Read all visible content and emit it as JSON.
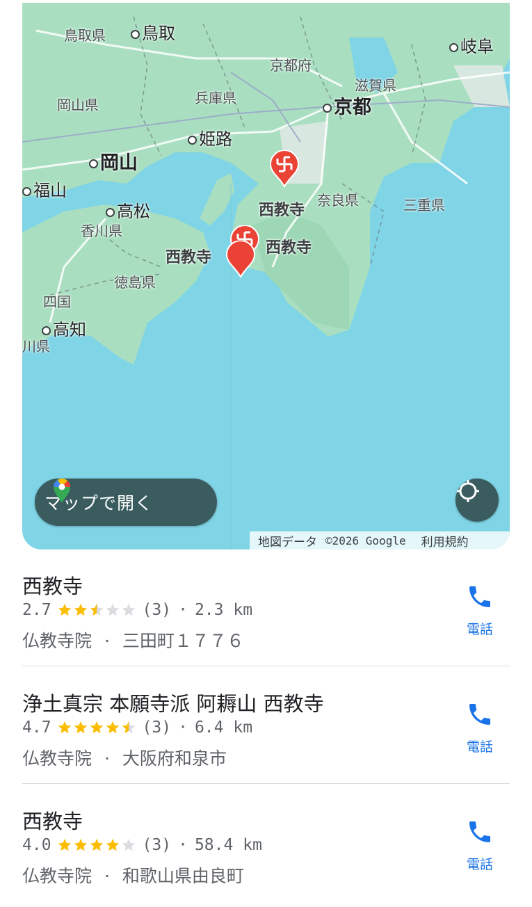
{
  "map": {
    "labels": {
      "tottori_pref": "鳥取県",
      "tottori": "鳥取",
      "kyoto_pref": "京都府",
      "gifu": "岐阜",
      "okayama_pref": "岡山県",
      "hyogo_pref": "兵庫県",
      "shiga_pref": "滋賀県",
      "kyoto": "京都",
      "himeji": "姫路",
      "okayama": "岡山",
      "fukuyama": "福山",
      "nara_pref": "奈良県",
      "mie_pref": "三重県",
      "takamatsu": "高松",
      "kagawa_pref": "香川県",
      "tokushima_pref": "徳島県",
      "shikoku": "四国",
      "kochi": "高知",
      "kochi_pref_partial": "川県"
    },
    "pins": [
      {
        "label": "西教寺"
      },
      {
        "label": "西教寺"
      },
      {
        "label": "西教寺"
      }
    ],
    "open_map_label": "マップで開く",
    "attribution": {
      "data": "地図データ",
      "copyright": "©2026 Google",
      "terms": "利用規約"
    }
  },
  "results": [
    {
      "name": "西教寺",
      "rating": "2.7",
      "rating_value": 2.7,
      "reviews": "(3)",
      "distance": "2.3 km",
      "category": "仏教寺院",
      "address": "三田町１７７６",
      "call_label": "電話"
    },
    {
      "name": "浄土真宗 本願寺派 阿耨山 西教寺",
      "rating": "4.7",
      "rating_value": 4.7,
      "reviews": "(3)",
      "distance": "6.4 km",
      "category": "仏教寺院",
      "address": "大阪府和泉市",
      "call_label": "電話"
    },
    {
      "name": "西教寺",
      "rating": "4.0",
      "rating_value": 4.0,
      "reviews": "(3)",
      "distance": "58.4 km",
      "category": "仏教寺院",
      "address": "和歌山県由良町",
      "call_label": "電話"
    }
  ],
  "separator": "·",
  "colors": {
    "star_filled": "#fbbc04",
    "star_empty": "#dadce0",
    "call_blue": "#1a73e8",
    "pin_red": "#ea4335",
    "map_sea": "#7fd4e6",
    "map_land": "#a9dfc0",
    "button_bg": "#3a5c5f"
  }
}
